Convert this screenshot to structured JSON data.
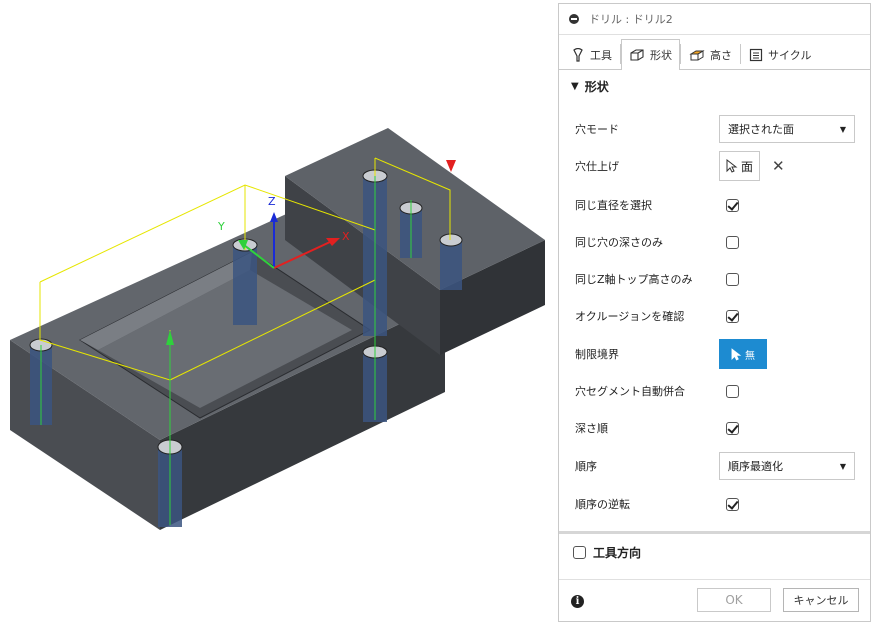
{
  "dialog": {
    "title": "ドリル : ドリル2",
    "tabs": [
      {
        "label": "工具",
        "icon": "tool-icon"
      },
      {
        "label": "形状",
        "icon": "geometry-icon"
      },
      {
        "label": "高さ",
        "icon": "heights-icon"
      },
      {
        "label": "サイクル",
        "icon": "cycle-icon"
      }
    ],
    "active_tab": "形状",
    "section_title": "形状",
    "fields": {
      "hole_mode": {
        "label": "穴モード",
        "value": "選択された面"
      },
      "hole_faces": {
        "label": "穴仕上げ",
        "value": "面"
      },
      "select_same_diameter": {
        "label": "同じ直径を選択",
        "checked": true
      },
      "same_hole_depth_only": {
        "label": "同じ穴の深さのみ",
        "checked": false
      },
      "same_z_top_only": {
        "label": "同じZ軸トップ高さのみ",
        "checked": false
      },
      "check_occlusion": {
        "label": "オクルージョンを確認",
        "checked": true
      },
      "boundary": {
        "label": "制限境界",
        "value": "無"
      },
      "auto_merge_segments": {
        "label": "穴セグメント自動併合",
        "checked": false
      },
      "depth_order": {
        "label": "深さ順",
        "checked": true
      },
      "ordering": {
        "label": "順序",
        "value": "順序最適化"
      },
      "reverse_order": {
        "label": "順序の逆転",
        "checked": true
      }
    },
    "tool_orientation": {
      "label": "工具方向",
      "checked": false
    },
    "buttons": {
      "ok": "OK",
      "cancel": "キャンセル"
    }
  },
  "axes": {
    "x": "X",
    "y": "Y",
    "z": "Z"
  },
  "colors": {
    "accent": "#1d8bd1",
    "wire": "#e6e600",
    "part_top": "#5f6368",
    "part_side": "#3d4044"
  }
}
